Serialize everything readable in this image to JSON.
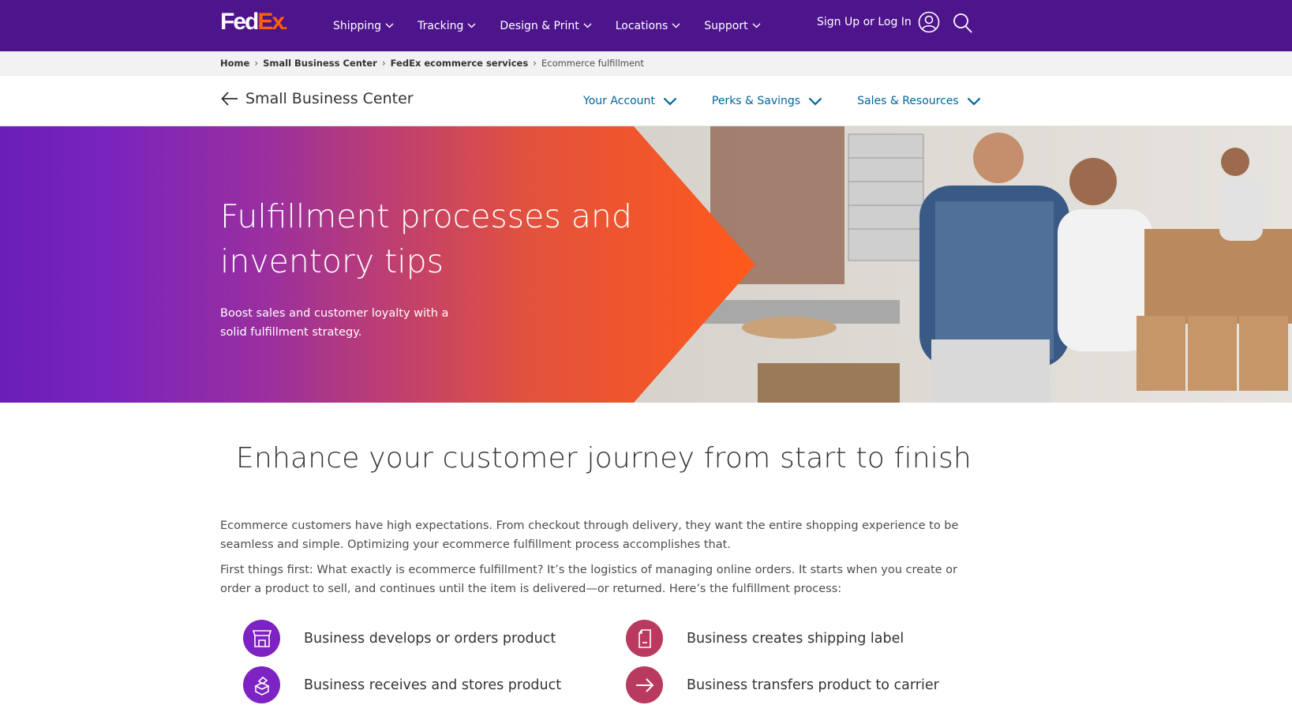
{
  "header": {
    "logo_fed": "Fed",
    "logo_ex": "Ex",
    "logo_dot": ".",
    "nav": [
      {
        "label": "Shipping"
      },
      {
        "label": "Tracking"
      },
      {
        "label": "Design & Print"
      },
      {
        "label": "Locations"
      },
      {
        "label": "Support"
      }
    ],
    "signin_label": "Sign Up or Log In",
    "brand_purple": "#4d148c",
    "brand_orange": "#ff6200"
  },
  "breadcrumb": [
    {
      "label": "Home"
    },
    {
      "label": "Small Business Center"
    },
    {
      "label": "FedEx ecommerce services"
    },
    {
      "label": "Ecommerce fulfillment"
    }
  ],
  "subnav": {
    "back_label": "Small Business Center",
    "links": [
      {
        "label": "Your Account"
      },
      {
        "label": "Perks & Savings"
      },
      {
        "label": "Sales & Resources"
      }
    ],
    "link_color": "#00649c"
  },
  "hero": {
    "title": "Fulfillment processes and inventory tips",
    "subtitle": "Boost sales and customer loyalty with a solid fulfillment strategy."
  },
  "content": {
    "heading": "Enhance your customer journey from start to finish",
    "paragraph1": "Ecommerce customers have high expectations. From checkout through delivery, they want the entire shopping experience to be seamless and simple. Optimizing your ecommerce fulfillment process accomplishes that.",
    "paragraph2": "First things first: What exactly is ecommerce fulfillment? It’s the logistics of managing online orders. It starts when you create or order a product to sell, and continues until the item is delivered—or returned. Here’s the fulfillment process:",
    "steps": [
      {
        "label": "Business develops or orders product",
        "icon": "storefront-icon",
        "color": "#7d22c3"
      },
      {
        "label": "Business creates shipping label",
        "icon": "label-icon",
        "color": "#b93a5e"
      },
      {
        "label": "Business receives and stores product",
        "icon": "boxes-icon",
        "color": "#7d22c3"
      },
      {
        "label": "Business transfers product to carrier",
        "icon": "arrow-right-icon",
        "color": "#b93a5e"
      }
    ]
  }
}
